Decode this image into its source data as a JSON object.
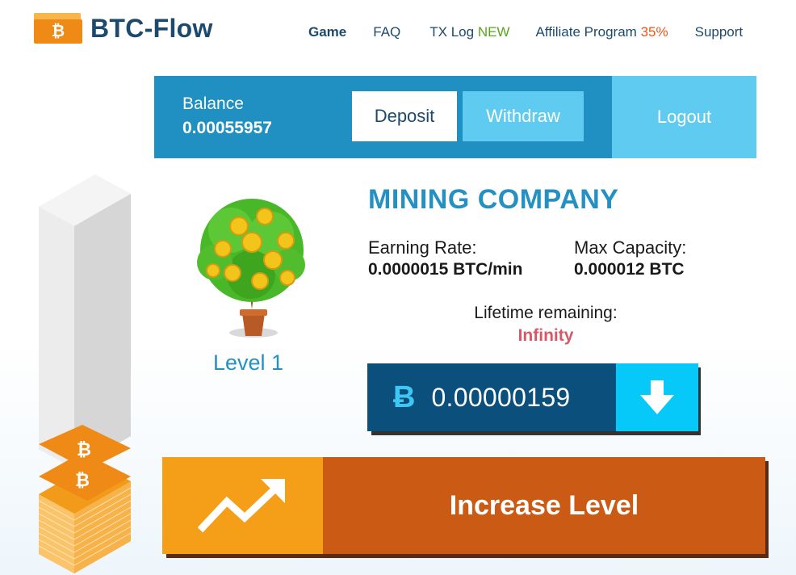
{
  "brand": {
    "name": "BTC-Flow",
    "logo_icon": "bitcoin-icon",
    "logo_glyph": "₿"
  },
  "nav": {
    "game": "Game",
    "faq": "FAQ",
    "tx_log": "TX Log",
    "tx_log_badge": "NEW",
    "affiliate": "Affiliate Program",
    "affiliate_badge": "35%",
    "support": "Support"
  },
  "balance": {
    "label": "Balance",
    "value": "0.00055957"
  },
  "actions": {
    "deposit": "Deposit",
    "withdraw": "Withdraw",
    "logout": "Logout"
  },
  "mining": {
    "title": "MINING COMPANY",
    "level": "Level 1",
    "earning_rate_label": "Earning Rate:",
    "earning_rate_value": "0.0000015 BTC/min",
    "max_capacity_label": "Max Capacity:",
    "max_capacity_value": "0.000012 BTC",
    "lifetime_label": "Lifetime remaining:",
    "lifetime_value": "Infinity"
  },
  "collect": {
    "symbol": "Ƀ",
    "amount": "0.00000159",
    "icon": "download-arrow-icon"
  },
  "increase": {
    "label": "Increase Level",
    "icon": "trend-up-arrow-icon"
  },
  "colors": {
    "primary": "#2090c2",
    "light_blue": "#5fcbf1",
    "navy": "#0b4f7c",
    "cyan": "#06c8f9",
    "orange": "#f59e17",
    "dark_orange": "#cb5a14",
    "brand_text": "#1d4a6c",
    "badge_green": "#5aa520",
    "badge_red": "#e3581c",
    "infinity_red": "#d85866"
  }
}
